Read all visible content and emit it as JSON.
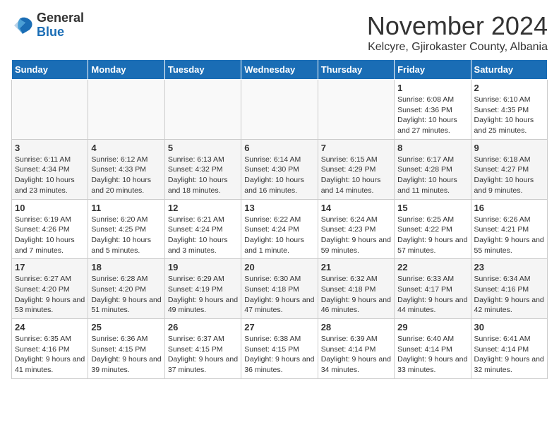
{
  "logo": {
    "general": "General",
    "blue": "Blue"
  },
  "title": "November 2024",
  "subtitle": "Kelcyre, Gjirokaster County, Albania",
  "headers": [
    "Sunday",
    "Monday",
    "Tuesday",
    "Wednesday",
    "Thursday",
    "Friday",
    "Saturday"
  ],
  "weeks": [
    [
      {
        "day": "",
        "info": ""
      },
      {
        "day": "",
        "info": ""
      },
      {
        "day": "",
        "info": ""
      },
      {
        "day": "",
        "info": ""
      },
      {
        "day": "",
        "info": ""
      },
      {
        "day": "1",
        "info": "Sunrise: 6:08 AM\nSunset: 4:36 PM\nDaylight: 10 hours and 27 minutes."
      },
      {
        "day": "2",
        "info": "Sunrise: 6:10 AM\nSunset: 4:35 PM\nDaylight: 10 hours and 25 minutes."
      }
    ],
    [
      {
        "day": "3",
        "info": "Sunrise: 6:11 AM\nSunset: 4:34 PM\nDaylight: 10 hours and 23 minutes."
      },
      {
        "day": "4",
        "info": "Sunrise: 6:12 AM\nSunset: 4:33 PM\nDaylight: 10 hours and 20 minutes."
      },
      {
        "day": "5",
        "info": "Sunrise: 6:13 AM\nSunset: 4:32 PM\nDaylight: 10 hours and 18 minutes."
      },
      {
        "day": "6",
        "info": "Sunrise: 6:14 AM\nSunset: 4:30 PM\nDaylight: 10 hours and 16 minutes."
      },
      {
        "day": "7",
        "info": "Sunrise: 6:15 AM\nSunset: 4:29 PM\nDaylight: 10 hours and 14 minutes."
      },
      {
        "day": "8",
        "info": "Sunrise: 6:17 AM\nSunset: 4:28 PM\nDaylight: 10 hours and 11 minutes."
      },
      {
        "day": "9",
        "info": "Sunrise: 6:18 AM\nSunset: 4:27 PM\nDaylight: 10 hours and 9 minutes."
      }
    ],
    [
      {
        "day": "10",
        "info": "Sunrise: 6:19 AM\nSunset: 4:26 PM\nDaylight: 10 hours and 7 minutes."
      },
      {
        "day": "11",
        "info": "Sunrise: 6:20 AM\nSunset: 4:25 PM\nDaylight: 10 hours and 5 minutes."
      },
      {
        "day": "12",
        "info": "Sunrise: 6:21 AM\nSunset: 4:24 PM\nDaylight: 10 hours and 3 minutes."
      },
      {
        "day": "13",
        "info": "Sunrise: 6:22 AM\nSunset: 4:24 PM\nDaylight: 10 hours and 1 minute."
      },
      {
        "day": "14",
        "info": "Sunrise: 6:24 AM\nSunset: 4:23 PM\nDaylight: 9 hours and 59 minutes."
      },
      {
        "day": "15",
        "info": "Sunrise: 6:25 AM\nSunset: 4:22 PM\nDaylight: 9 hours and 57 minutes."
      },
      {
        "day": "16",
        "info": "Sunrise: 6:26 AM\nSunset: 4:21 PM\nDaylight: 9 hours and 55 minutes."
      }
    ],
    [
      {
        "day": "17",
        "info": "Sunrise: 6:27 AM\nSunset: 4:20 PM\nDaylight: 9 hours and 53 minutes."
      },
      {
        "day": "18",
        "info": "Sunrise: 6:28 AM\nSunset: 4:20 PM\nDaylight: 9 hours and 51 minutes."
      },
      {
        "day": "19",
        "info": "Sunrise: 6:29 AM\nSunset: 4:19 PM\nDaylight: 9 hours and 49 minutes."
      },
      {
        "day": "20",
        "info": "Sunrise: 6:30 AM\nSunset: 4:18 PM\nDaylight: 9 hours and 47 minutes."
      },
      {
        "day": "21",
        "info": "Sunrise: 6:32 AM\nSunset: 4:18 PM\nDaylight: 9 hours and 46 minutes."
      },
      {
        "day": "22",
        "info": "Sunrise: 6:33 AM\nSunset: 4:17 PM\nDaylight: 9 hours and 44 minutes."
      },
      {
        "day": "23",
        "info": "Sunrise: 6:34 AM\nSunset: 4:16 PM\nDaylight: 9 hours and 42 minutes."
      }
    ],
    [
      {
        "day": "24",
        "info": "Sunrise: 6:35 AM\nSunset: 4:16 PM\nDaylight: 9 hours and 41 minutes."
      },
      {
        "day": "25",
        "info": "Sunrise: 6:36 AM\nSunset: 4:15 PM\nDaylight: 9 hours and 39 minutes."
      },
      {
        "day": "26",
        "info": "Sunrise: 6:37 AM\nSunset: 4:15 PM\nDaylight: 9 hours and 37 minutes."
      },
      {
        "day": "27",
        "info": "Sunrise: 6:38 AM\nSunset: 4:15 PM\nDaylight: 9 hours and 36 minutes."
      },
      {
        "day": "28",
        "info": "Sunrise: 6:39 AM\nSunset: 4:14 PM\nDaylight: 9 hours and 34 minutes."
      },
      {
        "day": "29",
        "info": "Sunrise: 6:40 AM\nSunset: 4:14 PM\nDaylight: 9 hours and 33 minutes."
      },
      {
        "day": "30",
        "info": "Sunrise: 6:41 AM\nSunset: 4:14 PM\nDaylight: 9 hours and 32 minutes."
      }
    ]
  ]
}
